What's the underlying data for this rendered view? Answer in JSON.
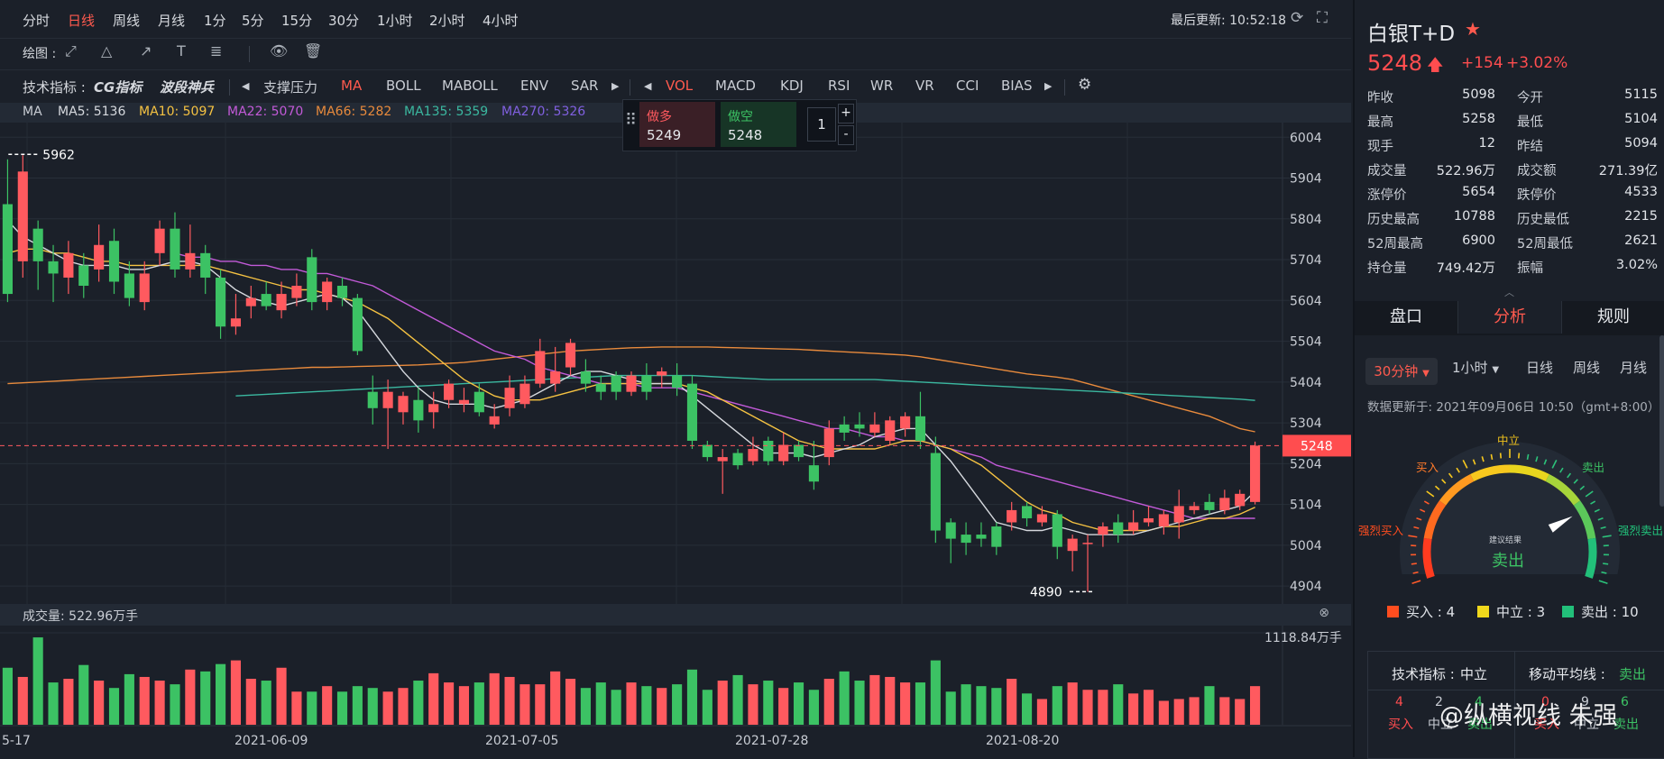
{
  "toolbar": {
    "periods": [
      "分时",
      "日线",
      "周线",
      "月线",
      "1分",
      "5分",
      "15分",
      "30分",
      "1小时",
      "2小时",
      "4小时"
    ],
    "active_period": "日线",
    "last_update": "最后更新: 10:52:18"
  },
  "drawbar": {
    "label": "绘图 :"
  },
  "indicators": {
    "label": "技术指标 :",
    "brand1": "CG指标",
    "brand2": "波段神兵",
    "main": [
      "支撑压力",
      "MA",
      "BOLL",
      "MABOLL",
      "ENV",
      "SAR"
    ],
    "sub": [
      "VOL",
      "MACD",
      "KDJ",
      "RSI",
      "WR",
      "VR",
      "CCI",
      "BIAS"
    ],
    "active_main": "MA",
    "active_sub": "VOL"
  },
  "ma_bar": {
    "label": "MA",
    "ma5": "MA5: 5136",
    "ma10": "MA10: 5097",
    "ma22": "MA22: 5070",
    "ma66": "MA66: 5282",
    "ma135": "MA135: 5359",
    "ma270": "MA270: 5326",
    "colors": {
      "ma5": "#d6d9de",
      "ma10": "#f5c242",
      "ma22": "#c25ad8",
      "ma66": "#e88a3c",
      "ma135": "#3bb8a0",
      "ma270": "#8060e0"
    }
  },
  "trade": {
    "long_label": "做多",
    "long_price": "5249",
    "short_label": "做空",
    "short_price": "5248",
    "qty": "1",
    "plus": "+",
    "minus": "-"
  },
  "chart_data": {
    "type": "candlestick",
    "y_ticks": [
      6004,
      5904,
      5804,
      5704,
      5604,
      5504,
      5404,
      5304,
      5204,
      5104,
      5004,
      4904
    ],
    "ylim": [
      4860,
      6040
    ],
    "x_labels": [
      "5-17",
      "2021-06-09",
      "2021-07-05",
      "2021-07-28",
      "2021-08-20"
    ],
    "high_label": "5962",
    "low_label": "4890",
    "current_price": "5248",
    "candles": [
      [
        5840,
        5620,
        5950,
        5600
      ],
      [
        5700,
        5920,
        5960,
        5660
      ],
      [
        5780,
        5700,
        5800,
        5630
      ],
      [
        5700,
        5670,
        5740,
        5600
      ],
      [
        5660,
        5720,
        5750,
        5620
      ],
      [
        5690,
        5640,
        5720,
        5610
      ],
      [
        5680,
        5740,
        5790,
        5650
      ],
      [
        5750,
        5650,
        5780,
        5620
      ],
      [
        5670,
        5610,
        5700,
        5590
      ],
      [
        5600,
        5670,
        5700,
        5580
      ],
      [
        5720,
        5780,
        5800,
        5690
      ],
      [
        5780,
        5680,
        5820,
        5660
      ],
      [
        5680,
        5720,
        5790,
        5660
      ],
      [
        5720,
        5660,
        5740,
        5620
      ],
      [
        5660,
        5540,
        5680,
        5510
      ],
      [
        5540,
        5560,
        5620,
        5520
      ],
      [
        5590,
        5610,
        5640,
        5560
      ],
      [
        5620,
        5590,
        5650,
        5580
      ],
      [
        5580,
        5620,
        5650,
        5560
      ],
      [
        5610,
        5640,
        5670,
        5590
      ],
      [
        5710,
        5600,
        5730,
        5580
      ],
      [
        5600,
        5650,
        5660,
        5580
      ],
      [
        5640,
        5610,
        5660,
        5590
      ],
      [
        5610,
        5480,
        5620,
        5470
      ],
      [
        5380,
        5340,
        5420,
        5300
      ],
      [
        5340,
        5380,
        5410,
        5240
      ],
      [
        5330,
        5370,
        5380,
        5300
      ],
      [
        5360,
        5310,
        5390,
        5280
      ],
      [
        5330,
        5350,
        5380,
        5290
      ],
      [
        5360,
        5400,
        5410,
        5340
      ],
      [
        5350,
        5360,
        5390,
        5330
      ],
      [
        5380,
        5330,
        5400,
        5320
      ],
      [
        5300,
        5320,
        5350,
        5290
      ],
      [
        5340,
        5390,
        5420,
        5320
      ],
      [
        5350,
        5400,
        5420,
        5340
      ],
      [
        5400,
        5480,
        5510,
        5390
      ],
      [
        5400,
        5430,
        5490,
        5380
      ],
      [
        5440,
        5500,
        5510,
        5420
      ],
      [
        5430,
        5400,
        5460,
        5380
      ],
      [
        5400,
        5380,
        5420,
        5360
      ],
      [
        5420,
        5380,
        5430,
        5360
      ],
      [
        5380,
        5420,
        5430,
        5370
      ],
      [
        5420,
        5380,
        5450,
        5360
      ],
      [
        5420,
        5430,
        5440,
        5390
      ],
      [
        5420,
        5390,
        5450,
        5370
      ],
      [
        5400,
        5260,
        5420,
        5240
      ],
      [
        5250,
        5220,
        5260,
        5210
      ],
      [
        5210,
        5220,
        5240,
        5130
      ],
      [
        5230,
        5200,
        5240,
        5190
      ],
      [
        5210,
        5240,
        5270,
        5200
      ],
      [
        5260,
        5210,
        5270,
        5200
      ],
      [
        5210,
        5250,
        5280,
        5200
      ],
      [
        5250,
        5220,
        5260,
        5210
      ],
      [
        5200,
        5160,
        5260,
        5140
      ],
      [
        5220,
        5290,
        5310,
        5200
      ],
      [
        5300,
        5280,
        5320,
        5260
      ],
      [
        5300,
        5290,
        5330,
        5270
      ],
      [
        5280,
        5300,
        5330,
        5270
      ],
      [
        5260,
        5310,
        5320,
        5250
      ],
      [
        5290,
        5320,
        5330,
        5270
      ],
      [
        5320,
        5260,
        5380,
        5240
      ],
      [
        5230,
        5040,
        5270,
        5010
      ],
      [
        5060,
        5020,
        5070,
        4960
      ],
      [
        5030,
        5010,
        5060,
        4980
      ],
      [
        5030,
        5020,
        5060,
        5000
      ],
      [
        5050,
        5000,
        5060,
        4980
      ],
      [
        5060,
        5090,
        5110,
        5040
      ],
      [
        5100,
        5070,
        5110,
        5050
      ],
      [
        5060,
        5080,
        5100,
        5050
      ],
      [
        5080,
        5000,
        5090,
        4970
      ],
      [
        4990,
        5020,
        5030,
        4940
      ],
      [
        5010,
        5010,
        5030,
        4890
      ],
      [
        5030,
        5050,
        5060,
        5000
      ],
      [
        5060,
        5030,
        5080,
        5010
      ],
      [
        5040,
        5060,
        5090,
        5030
      ],
      [
        5060,
        5070,
        5100,
        5050
      ],
      [
        5050,
        5080,
        5090,
        5030
      ],
      [
        5060,
        5100,
        5140,
        5020
      ],
      [
        5090,
        5100,
        5110,
        5080
      ],
      [
        5110,
        5090,
        5130,
        5080
      ],
      [
        5090,
        5120,
        5140,
        5080
      ],
      [
        5100,
        5130,
        5140,
        5090
      ],
      [
        5110,
        5248,
        5258,
        5104
      ]
    ],
    "volume": {
      "max_label": "1118.84万手",
      "values": [
        62,
        52,
        95,
        46,
        50,
        65,
        48,
        40,
        55,
        52,
        48,
        44,
        60,
        58,
        66,
        70,
        50,
        48,
        62,
        36,
        36,
        42,
        36,
        42,
        40,
        36,
        40,
        48,
        56,
        46,
        42,
        46,
        56,
        52,
        44,
        44,
        58,
        50,
        40,
        46,
        38,
        46,
        42,
        40,
        44,
        60,
        38,
        48,
        54,
        44,
        48,
        40,
        46,
        38,
        50,
        58,
        48,
        54,
        52,
        46,
        46,
        70,
        36,
        44,
        42,
        40,
        50,
        34,
        28,
        42,
        46,
        38,
        38,
        44,
        34,
        38,
        26,
        28,
        30,
        42,
        30,
        28,
        42
      ],
      "title": "成交量: 522.96万手"
    },
    "colors": {
      "up": "#ff5a5f",
      "down": "#3cc264"
    }
  },
  "ma_lines": {
    "ma5": [
      5800,
      5760,
      5740,
      5720,
      5700,
      5690,
      5690,
      5690,
      5680,
      5680,
      5690,
      5700,
      5700,
      5690,
      5660,
      5630,
      5610,
      5600,
      5590,
      5600,
      5610,
      5620,
      5610,
      5580,
      5530,
      5480,
      5430,
      5390,
      5360,
      5350,
      5350,
      5350,
      5340,
      5350,
      5360,
      5380,
      5400,
      5420,
      5430,
      5430,
      5420,
      5410,
      5400,
      5400,
      5400,
      5370,
      5340,
      5310,
      5280,
      5250,
      5230,
      5230,
      5230,
      5220,
      5230,
      5240,
      5250,
      5270,
      5280,
      5290,
      5290,
      5250,
      5210,
      5160,
      5110,
      5060,
      5050,
      5040,
      5040,
      5050,
      5040,
      5030,
      5030,
      5030,
      5030,
      5040,
      5050,
      5060,
      5070,
      5080,
      5090,
      5100,
      5136
    ],
    "ma10": [
      5720,
      5730,
      5730,
      5720,
      5720,
      5710,
      5700,
      5700,
      5690,
      5690,
      5690,
      5690,
      5690,
      5690,
      5680,
      5670,
      5660,
      5650,
      5640,
      5630,
      5630,
      5620,
      5610,
      5600,
      5580,
      5560,
      5530,
      5500,
      5470,
      5440,
      5410,
      5390,
      5370,
      5360,
      5360,
      5360,
      5370,
      5380,
      5390,
      5400,
      5400,
      5400,
      5400,
      5400,
      5400,
      5390,
      5380,
      5360,
      5340,
      5320,
      5300,
      5280,
      5260,
      5250,
      5240,
      5240,
      5240,
      5240,
      5250,
      5260,
      5260,
      5250,
      5240,
      5220,
      5200,
      5170,
      5140,
      5110,
      5090,
      5080,
      5060,
      5050,
      5040,
      5040,
      5040,
      5040,
      5050,
      5050,
      5060,
      5070,
      5070,
      5080,
      5097
    ],
    "ma22": [
      null,
      null,
      null,
      null,
      null,
      null,
      null,
      null,
      null,
      null,
      null,
      5720,
      5710,
      5710,
      5700,
      5700,
      5690,
      5690,
      5680,
      5680,
      5670,
      5670,
      5660,
      5650,
      5640,
      5620,
      5600,
      5580,
      5560,
      5540,
      5520,
      5500,
      5480,
      5470,
      5460,
      5440,
      5430,
      5420,
      5410,
      5400,
      5400,
      5400,
      5390,
      5390,
      5390,
      5380,
      5370,
      5360,
      5350,
      5340,
      5330,
      5320,
      5310,
      5300,
      5290,
      5290,
      5280,
      5270,
      5270,
      5260,
      5260,
      5250,
      5240,
      5230,
      5220,
      5200,
      5190,
      5180,
      5170,
      5160,
      5150,
      5140,
      5130,
      5120,
      5110,
      5100,
      5090,
      5080,
      5070,
      5070,
      5070,
      5070,
      5070
    ],
    "ma66": [
      5400,
      5402,
      5404,
      5406,
      5408,
      5410,
      5412,
      5414,
      5416,
      5418,
      5420,
      5422,
      5424,
      5426,
      5428,
      5430,
      5432,
      5434,
      5436,
      5438,
      5440,
      5440,
      5441,
      5442,
      5443,
      5444,
      5445,
      5446,
      5448,
      5450,
      5452,
      5456,
      5460,
      5464,
      5468,
      5472,
      5476,
      5480,
      5482,
      5484,
      5486,
      5488,
      5489,
      5490,
      5490,
      5490,
      5490,
      5489,
      5488,
      5487,
      5486,
      5485,
      5484,
      5482,
      5480,
      5478,
      5476,
      5474,
      5472,
      5470,
      5466,
      5460,
      5454,
      5448,
      5442,
      5436,
      5430,
      5424,
      5420,
      5416,
      5410,
      5400,
      5390,
      5380,
      5370,
      5360,
      5350,
      5340,
      5330,
      5320,
      5305,
      5290,
      5282
    ],
    "ma135": [
      null,
      null,
      null,
      null,
      null,
      null,
      null,
      null,
      null,
      null,
      null,
      null,
      null,
      null,
      null,
      5370,
      5372,
      5374,
      5376,
      5378,
      5380,
      5382,
      5384,
      5386,
      5388,
      5390,
      5392,
      5394,
      5396,
      5398,
      5400,
      5402,
      5404,
      5406,
      5408,
      5410,
      5412,
      5414,
      5416,
      5418,
      5420,
      5420,
      5420,
      5420,
      5420,
      5420,
      5418,
      5416,
      5414,
      5412,
      5410,
      5410,
      5410,
      5410,
      5410,
      5410,
      5410,
      5410,
      5408,
      5406,
      5404,
      5402,
      5400,
      5398,
      5396,
      5394,
      5392,
      5390,
      5388,
      5386,
      5384,
      5382,
      5380,
      5378,
      5376,
      5374,
      5372,
      5370,
      5368,
      5366,
      5364,
      5362,
      5359
    ]
  },
  "quote": {
    "name": "白银T+D",
    "price": "5248",
    "change": "+154",
    "change_pct": "+3.02%",
    "stats": [
      [
        "昨收",
        "5098",
        "今开",
        "5115"
      ],
      [
        "最高",
        "5258",
        "最低",
        "5104"
      ],
      [
        "现手",
        "12",
        "昨结",
        "5094"
      ],
      [
        "成交量",
        "522.96万",
        "成交额",
        "271.39亿"
      ],
      [
        "涨停价",
        "5654",
        "跌停价",
        "4533"
      ],
      [
        "历史最高",
        "10788",
        "历史最低",
        "2215"
      ],
      [
        "52周最高",
        "6900",
        "52周最低",
        "2621"
      ],
      [
        "持仓量",
        "749.42万",
        "振幅",
        "3.02%"
      ]
    ]
  },
  "tabs": [
    "盘口",
    "分析",
    "规则"
  ],
  "analysis": {
    "period_active": "30分钟",
    "periods": [
      "1小时",
      "日线",
      "周线",
      "月线"
    ],
    "updated": "数据更新于: 2021年09月06日 10:50（gmt+8:00）",
    "gauge": {
      "strong_buy": "强烈买入",
      "buy": "买入",
      "neutral": "中立",
      "sell": "卖出",
      "strong_sell": "强烈卖出",
      "center_small": "建议结果",
      "result": "卖出",
      "needle_level": 0.78
    },
    "legend": [
      {
        "label": "买入 : 4",
        "color": "#ff4d1f"
      },
      {
        "label": "中立 : 3",
        "color": "#f0d81c"
      },
      {
        "label": "卖出 : 10",
        "color": "#22c07a"
      }
    ],
    "summary": {
      "tech_label": "技术指标 :",
      "tech_value": "中立",
      "ma_label": "移动平均线 :",
      "ma_value": "卖出",
      "nums": [
        "4",
        "2",
        "4",
        "0",
        "9",
        "6"
      ],
      "words": [
        "买入",
        "中立",
        "卖出",
        "买入",
        "中立",
        "卖出"
      ]
    }
  },
  "watermark": "@纵横视线 朱强"
}
